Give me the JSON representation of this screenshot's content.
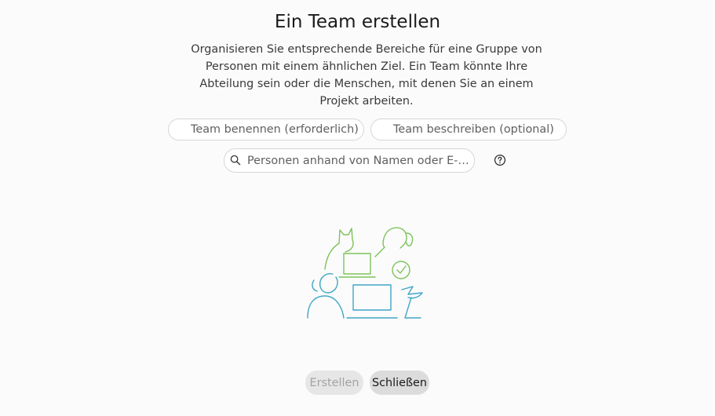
{
  "dialog": {
    "title": "Ein Team erstellen",
    "description": "Organisieren Sie entsprechende Bereiche für eine Gruppe von Personen mit einem ähnlichen Ziel. Ein Team könnte Ihre Abteilung sein oder die Menschen, mit denen Sie an einem Projekt arbeiten."
  },
  "form": {
    "team_name_placeholder": "Team benennen (erforderlich)",
    "team_description_placeholder": "Team beschreiben (optional)",
    "people_search_placeholder": "Personen anhand von Namen oder E-Mail-Adresse hinzufügen"
  },
  "icons": {
    "search": "search-icon",
    "help": "help-circle-icon",
    "illustration": "team-illustration"
  },
  "actions": {
    "create_label": "Erstellen",
    "close_label": "Schließen"
  },
  "colors": {
    "illustration_green": "#7cc35a",
    "illustration_blue": "#3ea6c6"
  }
}
